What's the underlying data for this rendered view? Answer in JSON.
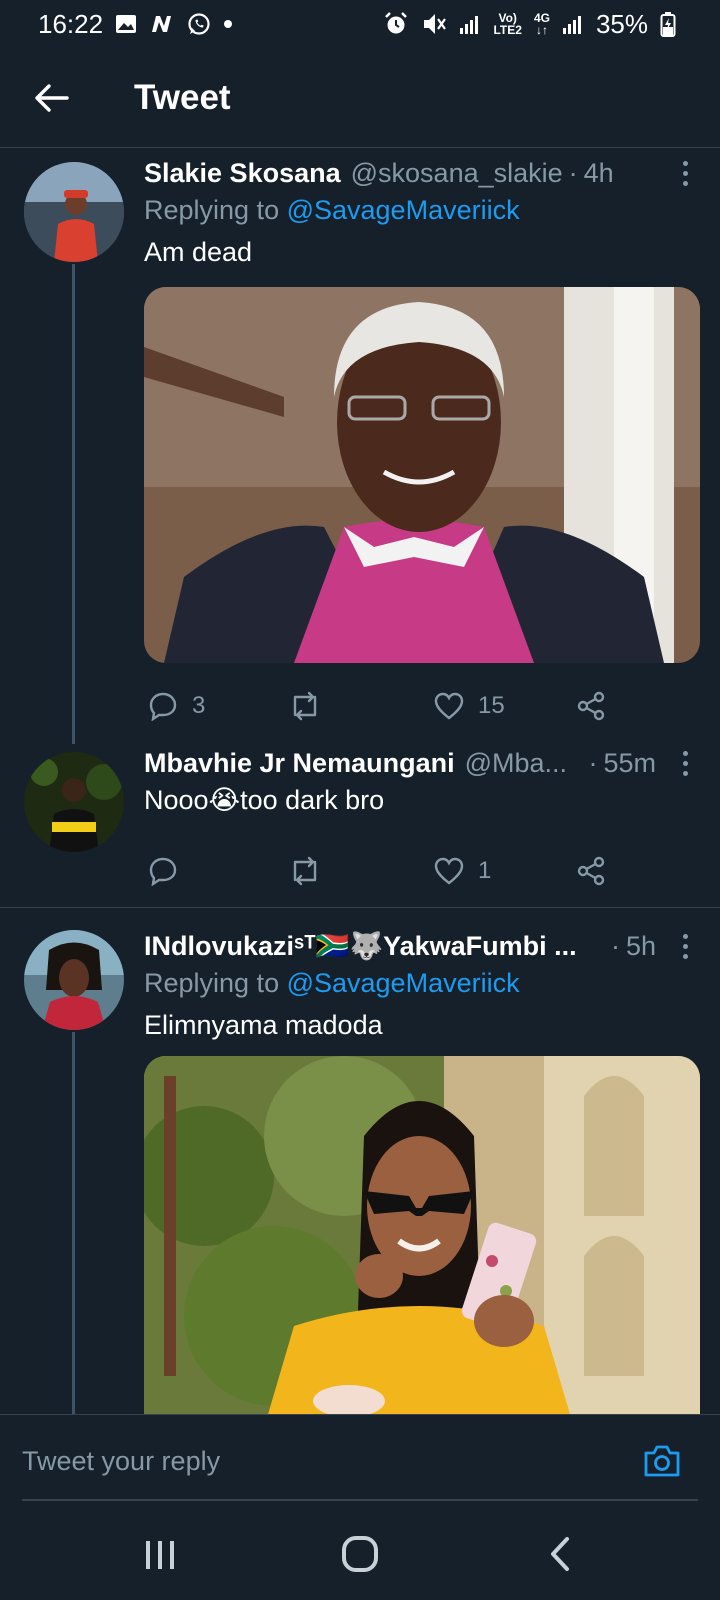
{
  "status_bar": {
    "time": "16:22",
    "left_icons": [
      "gallery-icon",
      "n-icon",
      "whatsapp-icon"
    ],
    "network_top": "Vo)",
    "network_bottom": "LTE2",
    "network_gen": "4G",
    "battery": "35%"
  },
  "header": {
    "title": "Tweet"
  },
  "tweets": [
    {
      "name": "Slakie Skosana",
      "handle": "@skosana_slakie",
      "dot": "·",
      "time": "4h",
      "replying_prefix": "Replying to ",
      "replying_to": "@SavageMaveriick",
      "text": "Am dead",
      "reply_count": "3",
      "retweet_count": "",
      "like_count": "15"
    },
    {
      "name": "Mbavhie Jr Nemaungani",
      "handle": "@Mba...",
      "dot": "·",
      "time": "55m",
      "text": "Nooo😭too dark bro",
      "reply_count": "",
      "retweet_count": "",
      "like_count": "1"
    },
    {
      "name": "INdlovukaziˢᵀ🇿🇦🐺YakwaFumbi ...",
      "handle": "",
      "dot": "·",
      "time": "5h",
      "replying_prefix": "Replying to ",
      "replying_to": "@SavageMaveriick",
      "text": "Elimnyama madoda"
    }
  ],
  "reply_bar": {
    "placeholder": "Tweet your reply"
  },
  "colors": {
    "background": "#15202b",
    "accent": "#1d9bf0",
    "secondary_text": "#8899a6",
    "divider": "#38444d"
  }
}
